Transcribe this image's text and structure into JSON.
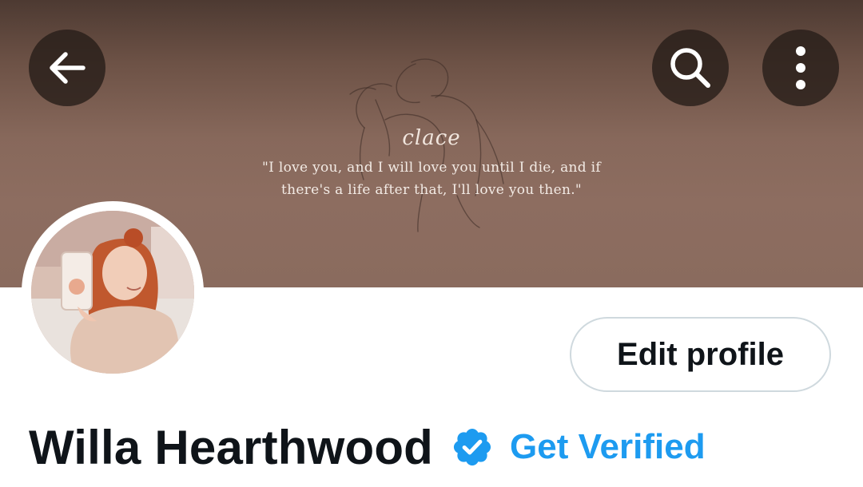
{
  "banner": {
    "signature": "clace",
    "quote_line1": "\"I love you, and I will love you until I die, and if",
    "quote_line2": "there's a life after that, I'll love you then.\""
  },
  "top_bar": {
    "back_icon": "arrow-left-icon",
    "search_icon": "search-icon",
    "more_icon": "more-vertical-icon"
  },
  "profile": {
    "edit_label": "Edit profile",
    "display_name": "Willa Hearthwood",
    "verified_icon": "verified-badge-icon",
    "get_verified_label": "Get Verified"
  },
  "colors": {
    "accent": "#1d9bf0",
    "text_primary": "#0f1419",
    "button_border": "#cfd9de",
    "banner": "#8a6b5e"
  }
}
